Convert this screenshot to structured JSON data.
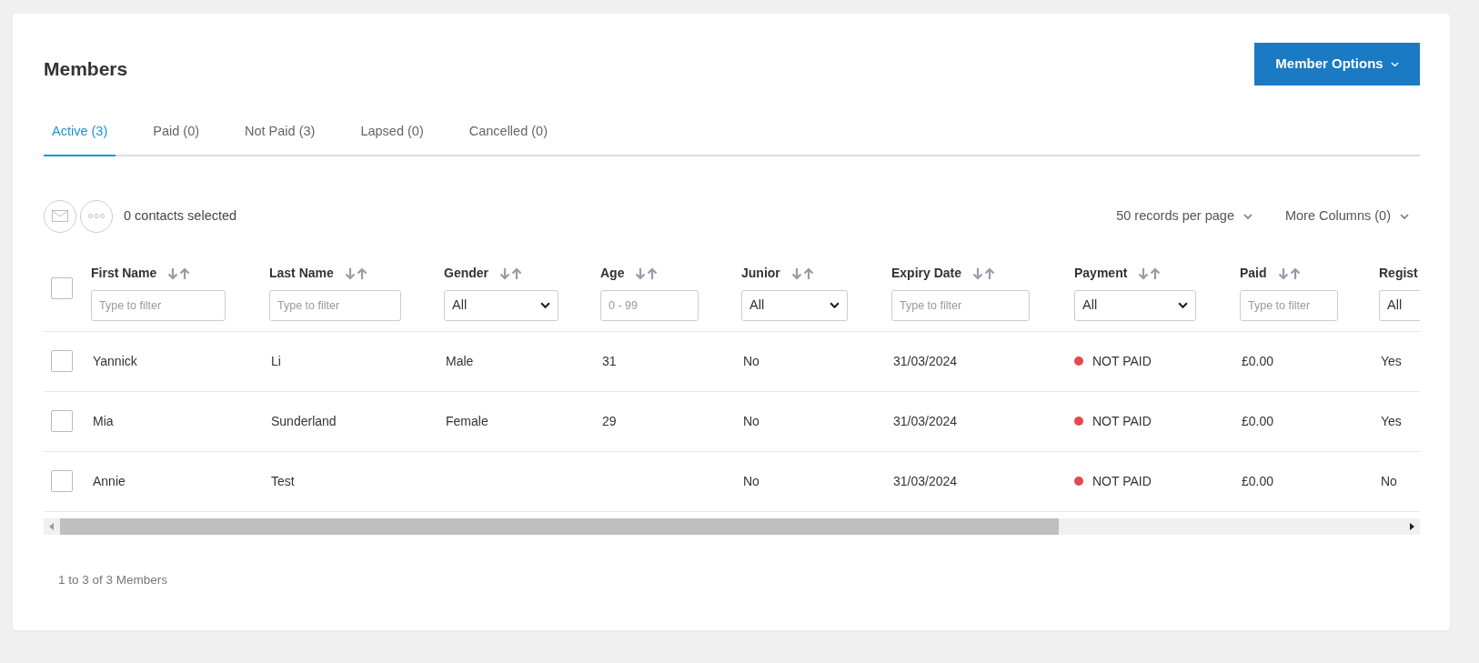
{
  "title": "Members",
  "options_button": {
    "label": "Member Options"
  },
  "tabs": [
    {
      "label": "Active (3)",
      "selected": true
    },
    {
      "label": "Paid (0)",
      "selected": false
    },
    {
      "label": "Not Paid (3)",
      "selected": false
    },
    {
      "label": "Lapsed (0)",
      "selected": false
    },
    {
      "label": "Cancelled (0)",
      "selected": false
    }
  ],
  "toolbar": {
    "selection_text": "0 contacts selected",
    "page_size": "50 records per page",
    "more_columns": "More Columns (0)"
  },
  "table": {
    "select_all": {
      "checked": false
    },
    "columns": [
      {
        "label": "First Name",
        "filter": {
          "kind": "text",
          "placeholder": "Type to filter"
        }
      },
      {
        "label": "Last Name",
        "filter": {
          "kind": "text",
          "placeholder": "Type to filter"
        }
      },
      {
        "label": "Gender",
        "filter": {
          "kind": "select",
          "value": "All"
        }
      },
      {
        "label": "Age",
        "filter": {
          "kind": "text",
          "placeholder": "0 - 99"
        }
      },
      {
        "label": "Junior",
        "filter": {
          "kind": "select",
          "value": "All"
        }
      },
      {
        "label": "Expiry Date",
        "filter": {
          "kind": "text",
          "placeholder": "Type to filter"
        }
      },
      {
        "label": "Payment",
        "filter": {
          "kind": "select",
          "value": "All"
        }
      },
      {
        "label": "Paid",
        "filter": {
          "kind": "text",
          "placeholder": "Type to filter"
        }
      },
      {
        "label": "Regist",
        "filter": {
          "kind": "select",
          "value": "All"
        }
      }
    ],
    "rows": [
      {
        "checked": false,
        "cells": [
          "Yannick",
          "Li",
          "Male",
          "31",
          "No",
          "31/03/2024",
          {
            "text": "NOT PAID",
            "color": "#e5484d"
          },
          "£0.00",
          "Yes"
        ]
      },
      {
        "checked": false,
        "cells": [
          "Mia",
          "Sunderland",
          "Female",
          "29",
          "No",
          "31/03/2024",
          {
            "text": "NOT PAID",
            "color": "#e5484d"
          },
          "£0.00",
          "Yes"
        ]
      },
      {
        "checked": false,
        "cells": [
          "Annie",
          "Test",
          "",
          "",
          "No",
          "31/03/2024",
          {
            "text": "NOT PAID",
            "color": "#e5484d"
          },
          "£0.00",
          "No"
        ]
      }
    ]
  },
  "footer": "1 to 3 of 3 Members"
}
